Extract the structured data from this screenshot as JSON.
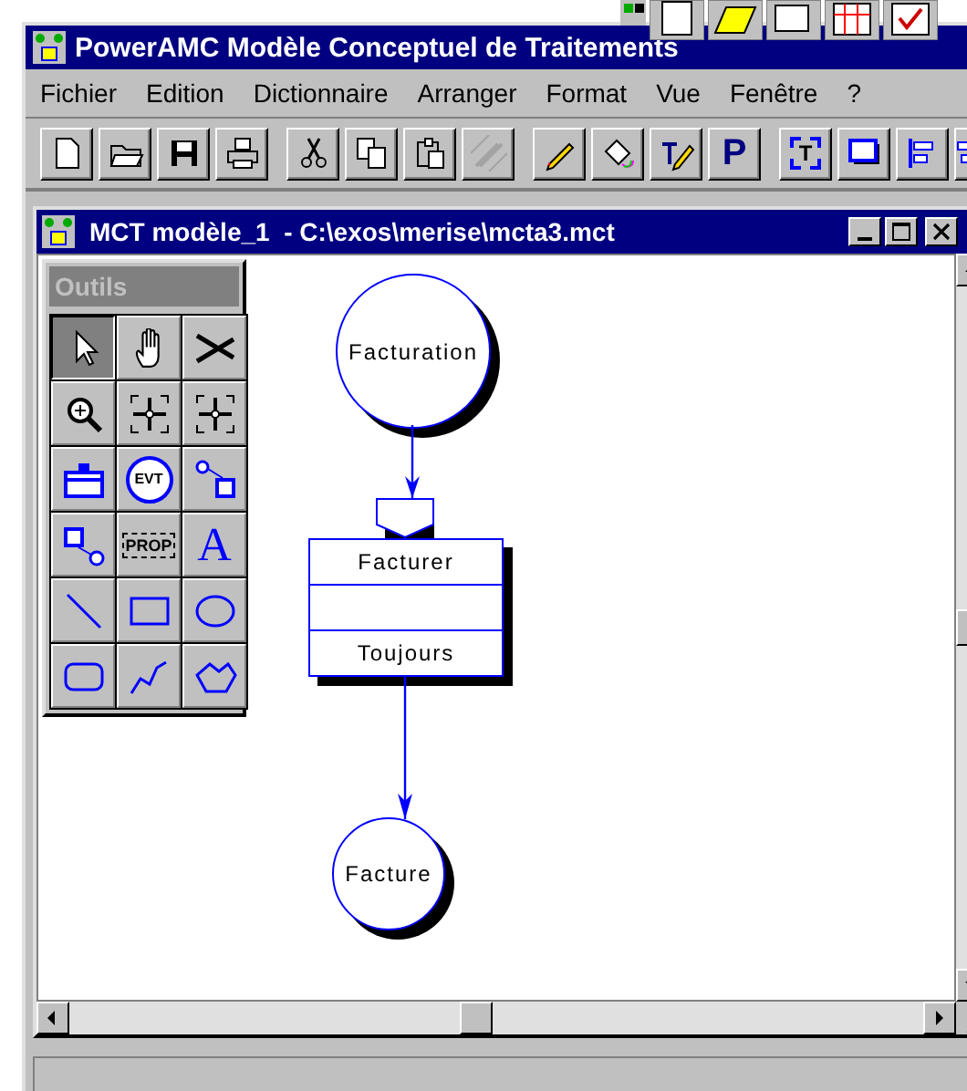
{
  "window": {
    "title": "PowerAMC Modèle Conceptuel de Traitements"
  },
  "menu": [
    {
      "label": "Fichier"
    },
    {
      "label": "Edition"
    },
    {
      "label": "Dictionnaire"
    },
    {
      "label": "Arranger"
    },
    {
      "label": "Format"
    },
    {
      "label": "Vue"
    },
    {
      "label": "Fenêtre"
    },
    {
      "label": "?"
    }
  ],
  "toolbar": [
    {
      "kind": "new"
    },
    {
      "kind": "open"
    },
    {
      "kind": "save"
    },
    {
      "kind": "print"
    },
    {
      "kind": "sep"
    },
    {
      "kind": "cut"
    },
    {
      "kind": "copy"
    },
    {
      "kind": "paste"
    },
    {
      "kind": "brush",
      "disabled": true
    },
    {
      "kind": "sep"
    },
    {
      "kind": "pencil"
    },
    {
      "kind": "bucket"
    },
    {
      "kind": "textpen"
    },
    {
      "kind": "letter",
      "glyph": "P"
    },
    {
      "kind": "sep"
    },
    {
      "kind": "textframe",
      "glyph": "T"
    },
    {
      "kind": "shadowrect"
    },
    {
      "kind": "alignleft"
    },
    {
      "kind": "aligncenter"
    }
  ],
  "document": {
    "title": "MCT modèle_1  - C:\\exos\\merise\\mcta3.mct"
  },
  "palette": {
    "title": "Outils",
    "tools": [
      {
        "kind": "pointer",
        "selected": true
      },
      {
        "kind": "hand",
        "selected": false
      },
      {
        "kind": "scissors",
        "selected": false
      },
      {
        "kind": "zoom",
        "selected": false
      },
      {
        "kind": "expand",
        "selected": false
      },
      {
        "kind": "contract",
        "selected": false
      },
      {
        "kind": "process",
        "selected": false
      },
      {
        "kind": "event",
        "glyph": "EVT",
        "selected": false
      },
      {
        "kind": "linkbox",
        "selected": false
      },
      {
        "kind": "boxlink",
        "selected": false
      },
      {
        "kind": "prop",
        "glyph": "PROP",
        "selected": false
      },
      {
        "kind": "text",
        "glyph": "A",
        "selected": false
      },
      {
        "kind": "line",
        "selected": false
      },
      {
        "kind": "rect",
        "selected": false
      },
      {
        "kind": "ellipse",
        "selected": false
      },
      {
        "kind": "roundrect",
        "selected": false
      },
      {
        "kind": "polyline",
        "selected": false
      },
      {
        "kind": "polygon",
        "selected": false
      }
    ]
  },
  "diagram": {
    "nodes": [
      {
        "kind": "event",
        "label": "Facturation"
      },
      {
        "kind": "operation",
        "name": "Facturer",
        "rule": "Toujours"
      },
      {
        "kind": "event",
        "label": "Facture"
      }
    ]
  }
}
